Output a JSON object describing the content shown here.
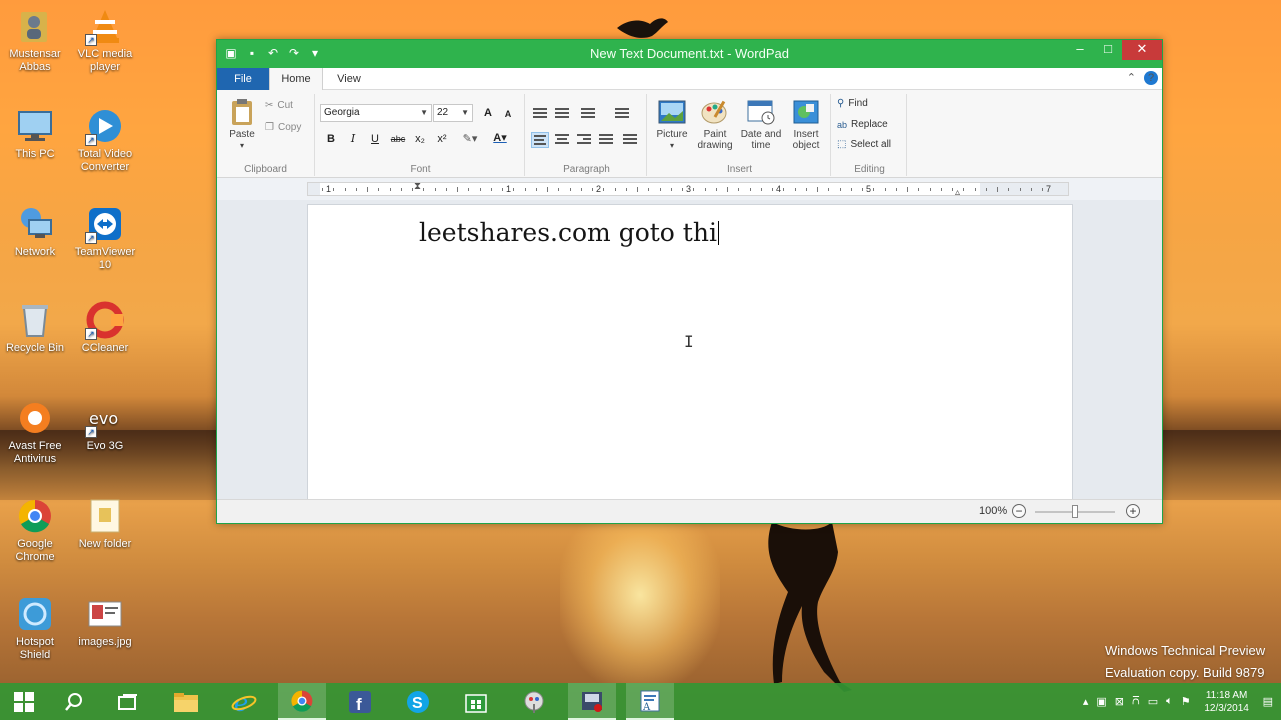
{
  "desktop": {
    "icons": [
      {
        "label": "Mustensar Abbas",
        "icon": "user-folder-icon"
      },
      {
        "label": "VLC media player",
        "icon": "vlc-icon"
      },
      {
        "label": "This PC",
        "icon": "computer-icon"
      },
      {
        "label": "Total Video Converter",
        "icon": "video-converter-icon"
      },
      {
        "label": "Network",
        "icon": "network-icon"
      },
      {
        "label": "TeamViewer 10",
        "icon": "teamviewer-icon"
      },
      {
        "label": "Recycle Bin",
        "icon": "recycle-bin-icon"
      },
      {
        "label": "CCleaner",
        "icon": "ccleaner-icon"
      },
      {
        "label": "Avast Free Antivirus",
        "icon": "avast-icon"
      },
      {
        "label": "Evo 3G",
        "icon": "evo-icon"
      },
      {
        "label": "Google Chrome",
        "icon": "chrome-icon"
      },
      {
        "label": "New folder",
        "icon": "folder-icon"
      },
      {
        "label": "Hotspot Shield",
        "icon": "hotspot-shield-icon"
      },
      {
        "label": "images.jpg",
        "icon": "image-file-icon"
      }
    ],
    "watermark_line1": "Windows Technical Preview",
    "watermark_line2": "Evaluation copy. Build 9879"
  },
  "window": {
    "title": "New Text Document.txt - WordPad",
    "controls": {
      "minimize": "–",
      "maximize": "□",
      "close": "✕"
    },
    "tabs": {
      "file": "File",
      "home": "Home",
      "view": "View"
    },
    "ribbon": {
      "clipboard": {
        "paste": "Paste",
        "cut": "Cut",
        "copy": "Copy",
        "label": "Clipboard"
      },
      "font": {
        "family": "Georgia",
        "size": "22",
        "label": "Font",
        "bold": "B",
        "italic": "I",
        "underline": "U",
        "strike": "abc",
        "subscript": "x₂",
        "superscript": "x²",
        "grow": "A",
        "shrink": "A"
      },
      "paragraph": {
        "label": "Paragraph"
      },
      "insert": {
        "picture": "Picture",
        "paint_line1": "Paint",
        "paint_line2": "drawing",
        "datetime_line1": "Date and",
        "datetime_line2": "time",
        "object_line1": "Insert",
        "object_line2": "object",
        "label": "Insert"
      },
      "editing": {
        "find": "Find",
        "replace": "Replace",
        "select_all": "Select all",
        "label": "Editing"
      }
    },
    "ruler_numbers": [
      "1",
      "1",
      "2",
      "3",
      "4",
      "5",
      "6",
      "7"
    ],
    "document_text": "leetshares.com goto thi",
    "status": {
      "zoom": "100%",
      "zoom_minus": "−",
      "zoom_plus": "+",
      "zoom_level": 1.0
    }
  },
  "taskbar": {
    "clock_time": "11:18 AM",
    "clock_date": "12/3/2014",
    "accent": "#34a034"
  }
}
